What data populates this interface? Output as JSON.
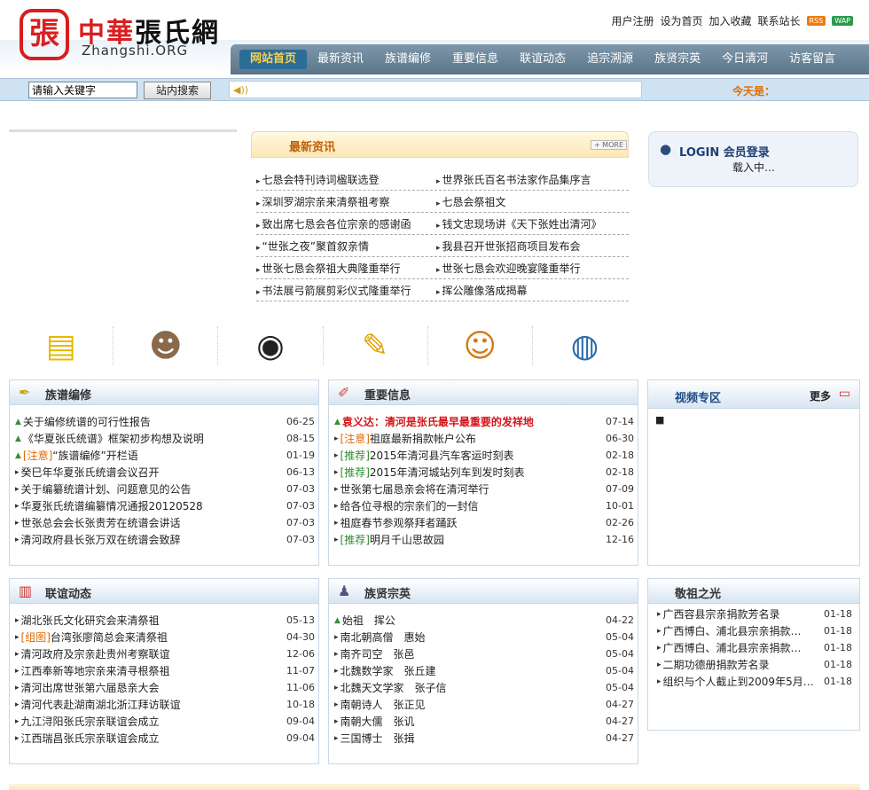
{
  "header": {
    "logo_char": "張",
    "site_name_red": "中華",
    "site_name_black": "張氏網",
    "site_domain": "Zhangshi.ORG",
    "top_links": [
      "用户注册",
      "设为首页",
      "加入收藏",
      "联系站长"
    ],
    "rss": "RSS",
    "wap": "WAP"
  },
  "nav": [
    "网站首页",
    "最新资讯",
    "族谱编修",
    "重要信息",
    "联谊动态",
    "追宗溯源",
    "族贤宗英",
    "今日清河",
    "访客留言"
  ],
  "search": {
    "input_value": "请输入关键字",
    "button_label": "站内搜索",
    "today_label": "今天是："
  },
  "news": {
    "title": "最新资讯",
    "more": "+ MORE",
    "items": [
      [
        "七恳会特刊诗词楹联选登",
        "世界张氏百名书法家作品集序言"
      ],
      [
        "深圳罗湖宗亲来清祭祖考察",
        "七恳会祭祖文"
      ],
      [
        "致出席七恳会各位宗亲的感谢函",
        "钱文忠现场讲《天下张姓出清河》"
      ],
      [
        "“世张之夜”聚首叙亲情",
        "我县召开世张招商项目发布会"
      ],
      [
        "世张七恳会祭祖大典隆重举行",
        "世张七恳会欢迎晚宴隆重举行"
      ],
      [
        "书法展弓箭展剪彩仪式隆重举行",
        "挥公雕像落成揭幕"
      ]
    ]
  },
  "login": {
    "title": "LOGIN 会员登录",
    "loading": "载入中…"
  },
  "icons": [
    "notebook-icon",
    "person-icon",
    "camera-icon",
    "document-icon",
    "users-icon",
    "globe-icon"
  ],
  "boxes": {
    "zupu": {
      "title": "族谱编修",
      "rows": [
        {
          "p": "",
          "t": "关于编修统谱的可行性报告",
          "d": "06-25"
        },
        {
          "p": "",
          "t": "《华夏张氏统谱》框架初步构想及说明",
          "d": "08-15"
        },
        {
          "p": "[注意]",
          "t": "“族谱编修”开栏语",
          "d": "01-19"
        },
        {
          "p": "",
          "t": "癸巳年华夏张氏统谱会议召开",
          "d": "06-13"
        },
        {
          "p": "",
          "t": "关于编纂统谱计划、问题意见的公告",
          "d": "07-03"
        },
        {
          "p": "",
          "t": "华夏张氏统谱编纂情况通报20120528",
          "d": "07-03"
        },
        {
          "p": "",
          "t": "世张总会会长张贵芳在统谱会讲话",
          "d": "07-03"
        },
        {
          "p": "",
          "t": "清河政府县长张万双在统谱会致辞",
          "d": "07-03"
        }
      ]
    },
    "zhongyao": {
      "title": "重要信息",
      "rows": [
        {
          "p": "",
          "t": "袁义达：清河是张氏最早最重要的发祥地",
          "d": "07-14",
          "red": true
        },
        {
          "p": "[注意]",
          "t": "祖庭最新捐款帐户公布",
          "d": "06-30"
        },
        {
          "p": "[推荐]",
          "t": "2015年清河县汽车客运时刻表",
          "d": "02-18"
        },
        {
          "p": "[推荐]",
          "t": "2015年清河城站列车到发时刻表",
          "d": "02-18"
        },
        {
          "p": "",
          "t": "世张第七届恳亲会将在清河举行",
          "d": "07-09"
        },
        {
          "p": "",
          "t": "给各位寻根的宗亲们的一封信",
          "d": "10-01"
        },
        {
          "p": "",
          "t": "祖庭春节参观祭拜者踊跃",
          "d": "02-26"
        },
        {
          "p": "[推荐]",
          "t": "明月千山思故园",
          "d": "12-16"
        }
      ]
    },
    "video": {
      "title": "视频专区",
      "more": "更多"
    },
    "lianyi": {
      "title": "联谊动态",
      "rows": [
        {
          "p": "",
          "t": "湖北张氏文化研究会来清祭祖",
          "d": "05-13"
        },
        {
          "p": "[组图]",
          "t": "台湾张廖简总会来清祭祖",
          "d": "04-30"
        },
        {
          "p": "",
          "t": "清河政府及宗亲赴贵州考察联谊",
          "d": "12-06"
        },
        {
          "p": "",
          "t": "江西奉新等地宗亲来清寻根祭祖",
          "d": "11-07"
        },
        {
          "p": "",
          "t": "清河出席世张第六届恳亲大会",
          "d": "11-06"
        },
        {
          "p": "",
          "t": "清河代表赴湖南湖北浙江拜访联谊",
          "d": "10-18"
        },
        {
          "p": "",
          "t": "九江浔阳张氏宗亲联谊会成立",
          "d": "09-04"
        },
        {
          "p": "",
          "t": "江西瑞昌张氏宗亲联谊会成立",
          "d": "09-04"
        }
      ]
    },
    "zuxian": {
      "title": "族贤宗英",
      "rows": [
        {
          "p": "",
          "t": "始祖　挥公",
          "d": "04-22"
        },
        {
          "p": "",
          "t": "南北朝高僧　惠始",
          "d": "05-04"
        },
        {
          "p": "",
          "t": "南齐司空　张邑",
          "d": "05-04"
        },
        {
          "p": "",
          "t": "北魏数学家　张丘建",
          "d": "05-04"
        },
        {
          "p": "",
          "t": "北魏天文学家　张子信",
          "d": "05-04"
        },
        {
          "p": "",
          "t": "南朝诗人　张正见",
          "d": "04-27"
        },
        {
          "p": "",
          "t": "南朝大儒　张讥",
          "d": "04-27"
        },
        {
          "p": "",
          "t": "三国博士　张揖",
          "d": "04-27"
        }
      ]
    },
    "jingzu": {
      "title": "敬祖之光",
      "rows": [
        {
          "t": "广西容县宗亲捐款芳名录",
          "d": "01-18"
        },
        {
          "t": "广西博白、浦北县宗亲捐款…",
          "d": "01-18"
        },
        {
          "t": "广西博白、浦北县宗亲捐款…",
          "d": "01-18"
        },
        {
          "t": "二期功德册捐款芳名录",
          "d": "01-18"
        },
        {
          "t": "组织与个人截止到2009年5月…",
          "d": "01-18"
        }
      ]
    }
  }
}
